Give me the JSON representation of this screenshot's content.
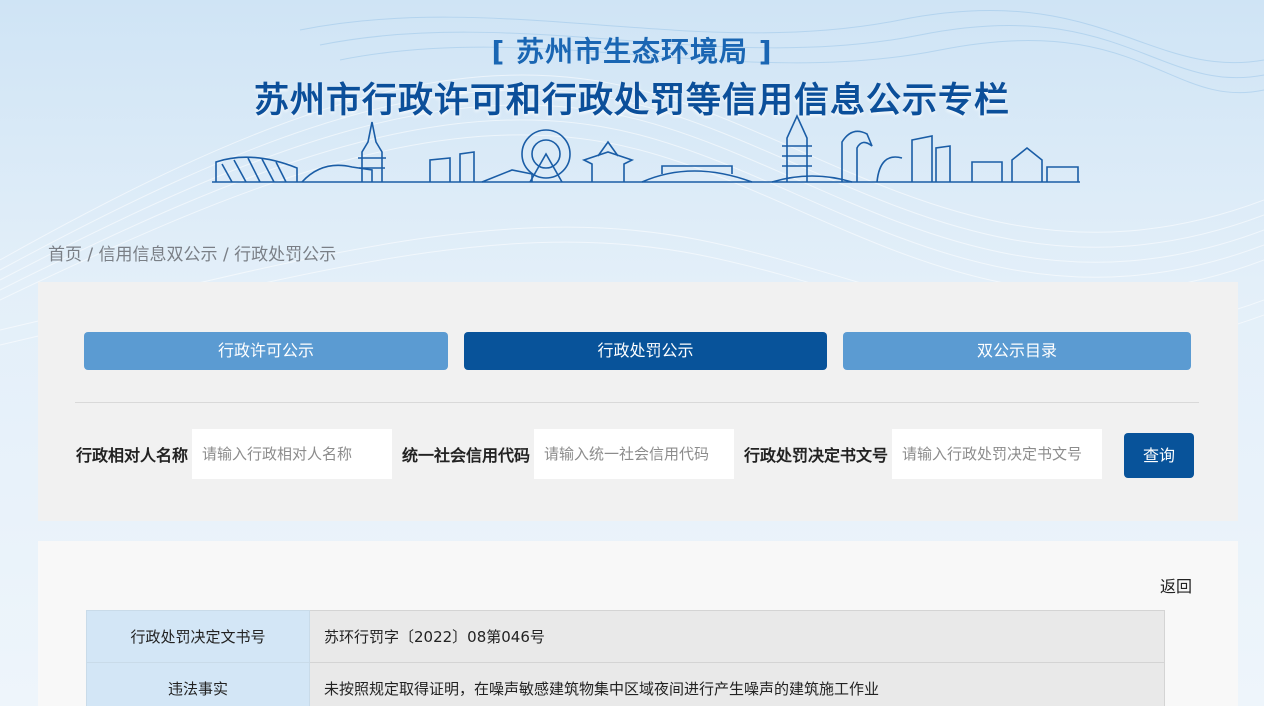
{
  "header": {
    "department": "[ 苏州市生态环境局 ]",
    "title": "苏州市行政许可和行政处罚等信用信息公示专栏"
  },
  "breadcrumb": {
    "home": "首页",
    "separator": " / ",
    "section": "信用信息双公示",
    "current": "行政处罚公示"
  },
  "tabs": [
    {
      "label": "行政许可公示",
      "active": false
    },
    {
      "label": "行政处罚公示",
      "active": true
    },
    {
      "label": "双公示目录",
      "active": false
    }
  ],
  "search": {
    "fields": [
      {
        "label": "行政相对人名称",
        "placeholder": "请输入行政相对人名称",
        "value": ""
      },
      {
        "label": "统一社会信用代码",
        "placeholder": "请输入统一社会信用代码",
        "value": ""
      },
      {
        "label": "行政处罚决定书文号",
        "placeholder": "请输入行政处罚决定书文号",
        "value": ""
      }
    ],
    "button_label": "查询"
  },
  "detail": {
    "back_label": "返回",
    "rows": [
      {
        "key": "行政处罚决定文书号",
        "value": "苏环行罚字〔2022〕08第046号"
      },
      {
        "key": "违法事实",
        "value": "未按照规定取得证明，在噪声敏感建筑物集中区域夜间进行产生噪声的建筑施工作业"
      }
    ]
  },
  "colors": {
    "primary": "#08539a",
    "tab_light": "#5b9bd2",
    "title": "#0b4f9a"
  }
}
